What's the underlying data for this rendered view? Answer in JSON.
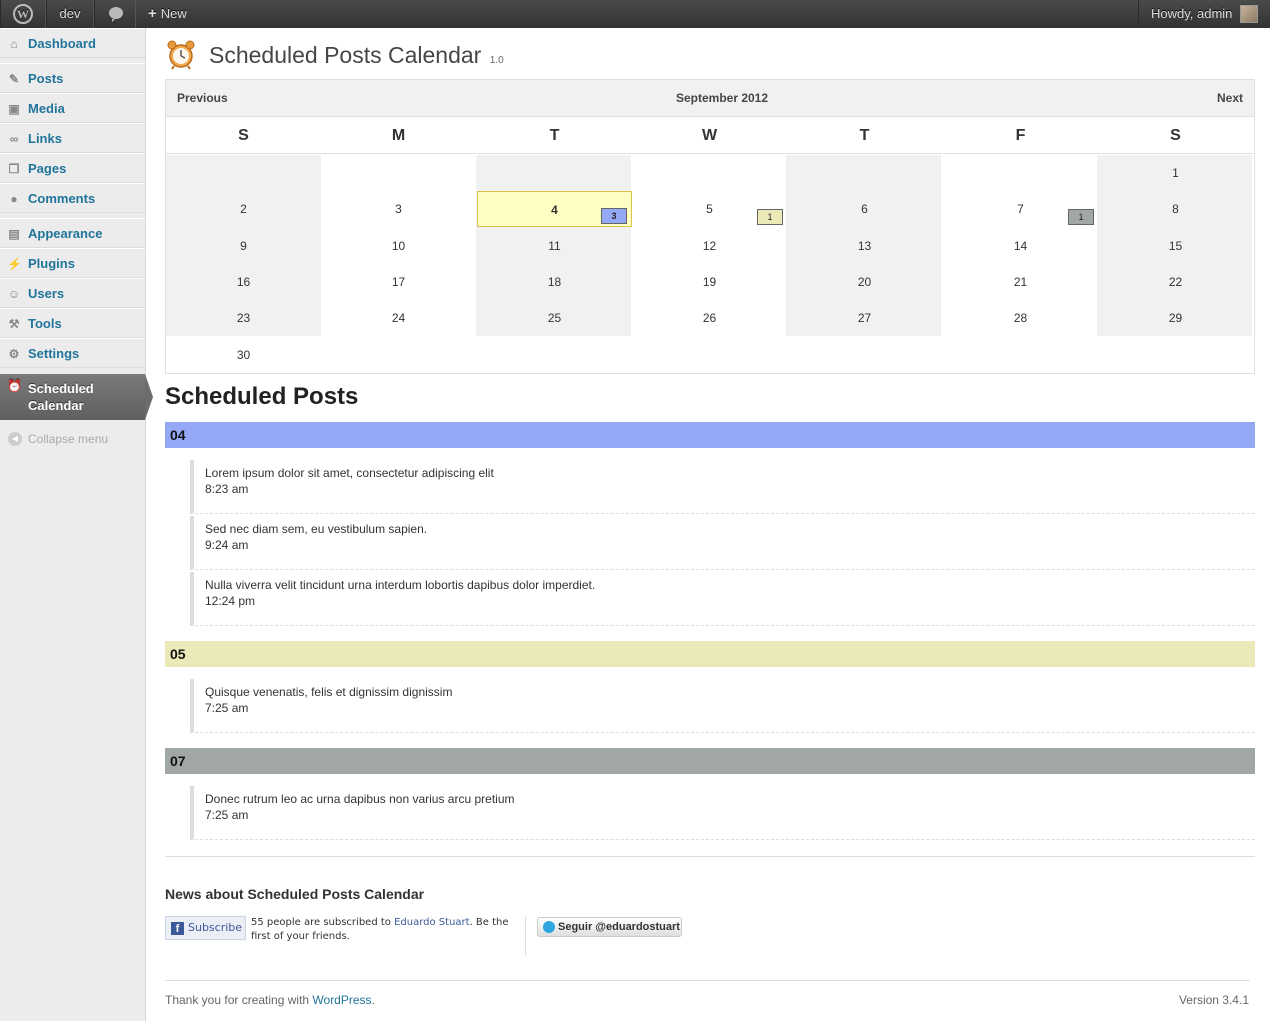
{
  "admin_bar": {
    "site_name": "dev",
    "new_label": "New",
    "greeting": "Howdy, admin"
  },
  "sidebar": {
    "items": [
      {
        "label": "Dashboard",
        "icon": "dashboard-icon"
      },
      {
        "label": "Posts",
        "icon": "pin-icon"
      },
      {
        "label": "Media",
        "icon": "media-icon"
      },
      {
        "label": "Links",
        "icon": "link-icon"
      },
      {
        "label": "Pages",
        "icon": "pages-icon"
      },
      {
        "label": "Comments",
        "icon": "comment-icon"
      },
      {
        "label": "Appearance",
        "icon": "appearance-icon"
      },
      {
        "label": "Plugins",
        "icon": "plugin-icon"
      },
      {
        "label": "Users",
        "icon": "users-icon"
      },
      {
        "label": "Tools",
        "icon": "tools-icon"
      },
      {
        "label": "Settings",
        "icon": "settings-icon"
      }
    ],
    "current_line1": "Scheduled",
    "current_line2": "Calendar",
    "collapse": "Collapse menu"
  },
  "header": {
    "title": "Scheduled Posts Calendar",
    "version": "1.0"
  },
  "calendar": {
    "prev": "Previous",
    "month": "September 2012",
    "next": "Next",
    "weekdays": [
      "S",
      "M",
      "T",
      "W",
      "T",
      "F",
      "S"
    ],
    "today": 4,
    "first_weekday": 6,
    "days_in_month": 30,
    "badges": [
      {
        "day": 4,
        "count": "3",
        "color": "#95a8f5"
      },
      {
        "day": 5,
        "count": "1",
        "color": "#ece9b9"
      },
      {
        "day": 7,
        "count": "1",
        "color": "#a1a8a4"
      }
    ]
  },
  "scheduled": {
    "title": "Scheduled Posts",
    "groups": [
      {
        "day": "04",
        "color": "#95a8f5",
        "posts": [
          {
            "title": "Lorem ipsum dolor sit amet, consectetur adipiscing elit",
            "time": "8:23 am"
          },
          {
            "title": "Sed nec diam sem, eu vestibulum sapien.",
            "time": "9:24 am"
          },
          {
            "title": "Nulla viverra velit tincidunt urna interdum lobortis dapibus dolor imperdiet.",
            "time": "12:24 pm"
          }
        ]
      },
      {
        "day": "05",
        "color": "#ece9b9",
        "posts": [
          {
            "title": "Quisque venenatis, felis et dignissim dignissim",
            "time": "7:25 am"
          }
        ]
      },
      {
        "day": "07",
        "color": "#a1a8a4",
        "posts": [
          {
            "title": "Donec rutrum leo ac urna dapibus non varius arcu pretium",
            "time": "7:25 am"
          }
        ]
      }
    ]
  },
  "news": {
    "title": "News about Scheduled Posts Calendar",
    "subscribe": "Subscribe",
    "fb_text_pre": "55 people are subscribed to ",
    "fb_link": "Eduardo Stuart",
    "fb_text_post": ". Be the first of your friends.",
    "twitter": "Seguir @eduardostuart"
  },
  "footer": {
    "thanks": "Thank you for creating with ",
    "wp_link": "WordPress",
    "period": ".",
    "version": "Version 3.4.1"
  }
}
